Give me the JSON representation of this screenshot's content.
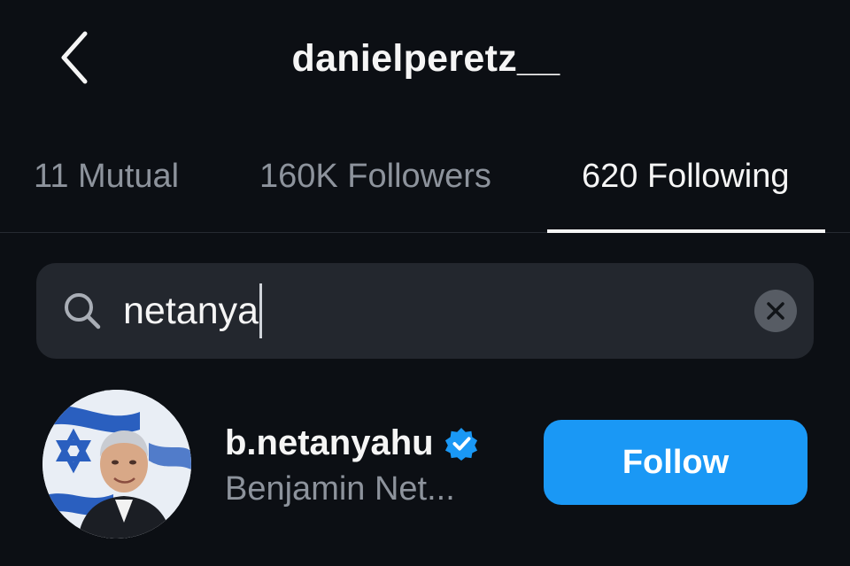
{
  "header": {
    "title": "danielperetz__",
    "back_icon": "chevron-left-icon"
  },
  "tabs": [
    {
      "label": "11 Mutual",
      "active": false
    },
    {
      "label": "160K Followers",
      "active": false
    },
    {
      "label": "620 Following",
      "active": true
    }
  ],
  "search": {
    "value": "netanya",
    "icon": "search-icon",
    "clear_icon": "clear-icon"
  },
  "results": [
    {
      "username": "b.netanyahu",
      "full_name": "Benjamin Net...",
      "verified": true,
      "follow_label": "Follow"
    }
  ],
  "colors": {
    "background": "#0c0f14",
    "search_bg": "#23272e",
    "muted_text": "#8d939c",
    "follow_button": "#1a98f5",
    "verified_badge": "#1a98f5"
  }
}
